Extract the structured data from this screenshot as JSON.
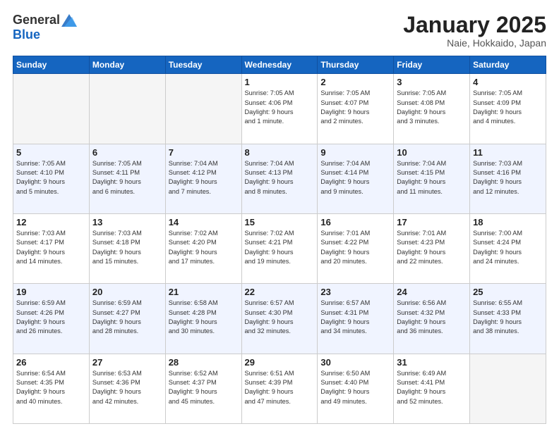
{
  "header": {
    "logo_general": "General",
    "logo_blue": "Blue",
    "month_title": "January 2025",
    "location": "Naie, Hokkaido, Japan"
  },
  "days_of_week": [
    "Sunday",
    "Monday",
    "Tuesday",
    "Wednesday",
    "Thursday",
    "Friday",
    "Saturday"
  ],
  "weeks": [
    [
      {
        "day": "",
        "info": ""
      },
      {
        "day": "",
        "info": ""
      },
      {
        "day": "",
        "info": ""
      },
      {
        "day": "1",
        "info": "Sunrise: 7:05 AM\nSunset: 4:06 PM\nDaylight: 9 hours\nand 1 minute."
      },
      {
        "day": "2",
        "info": "Sunrise: 7:05 AM\nSunset: 4:07 PM\nDaylight: 9 hours\nand 2 minutes."
      },
      {
        "day": "3",
        "info": "Sunrise: 7:05 AM\nSunset: 4:08 PM\nDaylight: 9 hours\nand 3 minutes."
      },
      {
        "day": "4",
        "info": "Sunrise: 7:05 AM\nSunset: 4:09 PM\nDaylight: 9 hours\nand 4 minutes."
      }
    ],
    [
      {
        "day": "5",
        "info": "Sunrise: 7:05 AM\nSunset: 4:10 PM\nDaylight: 9 hours\nand 5 minutes."
      },
      {
        "day": "6",
        "info": "Sunrise: 7:05 AM\nSunset: 4:11 PM\nDaylight: 9 hours\nand 6 minutes."
      },
      {
        "day": "7",
        "info": "Sunrise: 7:04 AM\nSunset: 4:12 PM\nDaylight: 9 hours\nand 7 minutes."
      },
      {
        "day": "8",
        "info": "Sunrise: 7:04 AM\nSunset: 4:13 PM\nDaylight: 9 hours\nand 8 minutes."
      },
      {
        "day": "9",
        "info": "Sunrise: 7:04 AM\nSunset: 4:14 PM\nDaylight: 9 hours\nand 9 minutes."
      },
      {
        "day": "10",
        "info": "Sunrise: 7:04 AM\nSunset: 4:15 PM\nDaylight: 9 hours\nand 11 minutes."
      },
      {
        "day": "11",
        "info": "Sunrise: 7:03 AM\nSunset: 4:16 PM\nDaylight: 9 hours\nand 12 minutes."
      }
    ],
    [
      {
        "day": "12",
        "info": "Sunrise: 7:03 AM\nSunset: 4:17 PM\nDaylight: 9 hours\nand 14 minutes."
      },
      {
        "day": "13",
        "info": "Sunrise: 7:03 AM\nSunset: 4:18 PM\nDaylight: 9 hours\nand 15 minutes."
      },
      {
        "day": "14",
        "info": "Sunrise: 7:02 AM\nSunset: 4:20 PM\nDaylight: 9 hours\nand 17 minutes."
      },
      {
        "day": "15",
        "info": "Sunrise: 7:02 AM\nSunset: 4:21 PM\nDaylight: 9 hours\nand 19 minutes."
      },
      {
        "day": "16",
        "info": "Sunrise: 7:01 AM\nSunset: 4:22 PM\nDaylight: 9 hours\nand 20 minutes."
      },
      {
        "day": "17",
        "info": "Sunrise: 7:01 AM\nSunset: 4:23 PM\nDaylight: 9 hours\nand 22 minutes."
      },
      {
        "day": "18",
        "info": "Sunrise: 7:00 AM\nSunset: 4:24 PM\nDaylight: 9 hours\nand 24 minutes."
      }
    ],
    [
      {
        "day": "19",
        "info": "Sunrise: 6:59 AM\nSunset: 4:26 PM\nDaylight: 9 hours\nand 26 minutes."
      },
      {
        "day": "20",
        "info": "Sunrise: 6:59 AM\nSunset: 4:27 PM\nDaylight: 9 hours\nand 28 minutes."
      },
      {
        "day": "21",
        "info": "Sunrise: 6:58 AM\nSunset: 4:28 PM\nDaylight: 9 hours\nand 30 minutes."
      },
      {
        "day": "22",
        "info": "Sunrise: 6:57 AM\nSunset: 4:30 PM\nDaylight: 9 hours\nand 32 minutes."
      },
      {
        "day": "23",
        "info": "Sunrise: 6:57 AM\nSunset: 4:31 PM\nDaylight: 9 hours\nand 34 minutes."
      },
      {
        "day": "24",
        "info": "Sunrise: 6:56 AM\nSunset: 4:32 PM\nDaylight: 9 hours\nand 36 minutes."
      },
      {
        "day": "25",
        "info": "Sunrise: 6:55 AM\nSunset: 4:33 PM\nDaylight: 9 hours\nand 38 minutes."
      }
    ],
    [
      {
        "day": "26",
        "info": "Sunrise: 6:54 AM\nSunset: 4:35 PM\nDaylight: 9 hours\nand 40 minutes."
      },
      {
        "day": "27",
        "info": "Sunrise: 6:53 AM\nSunset: 4:36 PM\nDaylight: 9 hours\nand 42 minutes."
      },
      {
        "day": "28",
        "info": "Sunrise: 6:52 AM\nSunset: 4:37 PM\nDaylight: 9 hours\nand 45 minutes."
      },
      {
        "day": "29",
        "info": "Sunrise: 6:51 AM\nSunset: 4:39 PM\nDaylight: 9 hours\nand 47 minutes."
      },
      {
        "day": "30",
        "info": "Sunrise: 6:50 AM\nSunset: 4:40 PM\nDaylight: 9 hours\nand 49 minutes."
      },
      {
        "day": "31",
        "info": "Sunrise: 6:49 AM\nSunset: 4:41 PM\nDaylight: 9 hours\nand 52 minutes."
      },
      {
        "day": "",
        "info": ""
      }
    ]
  ]
}
